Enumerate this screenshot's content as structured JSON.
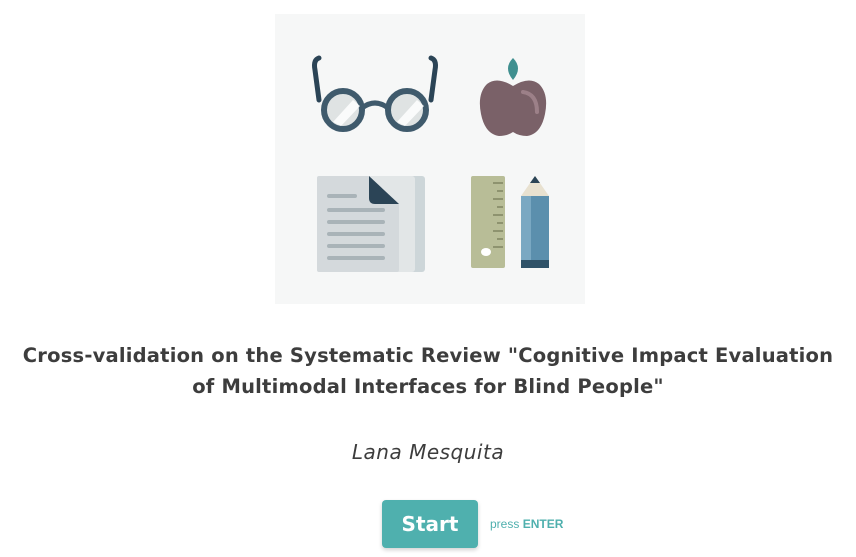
{
  "hero": {
    "icons": [
      "glasses-icon",
      "apple-icon",
      "document-icon",
      "ruler-icon",
      "pencil-icon"
    ]
  },
  "welcome": {
    "title_line1": "Cross-validation on the Systematic Review \"Cognitive Impact Evaluation",
    "title_line2": "of Multimodal Interfaces for Blind People\"",
    "author": "Lana Mesquita"
  },
  "start": {
    "button_label": "Start",
    "hint_prefix": "press",
    "hint_key": "ENTER"
  },
  "colors": {
    "accent": "#4fb0ae",
    "text": "#3d3d3d",
    "hero_background": "#f6f7f7"
  }
}
